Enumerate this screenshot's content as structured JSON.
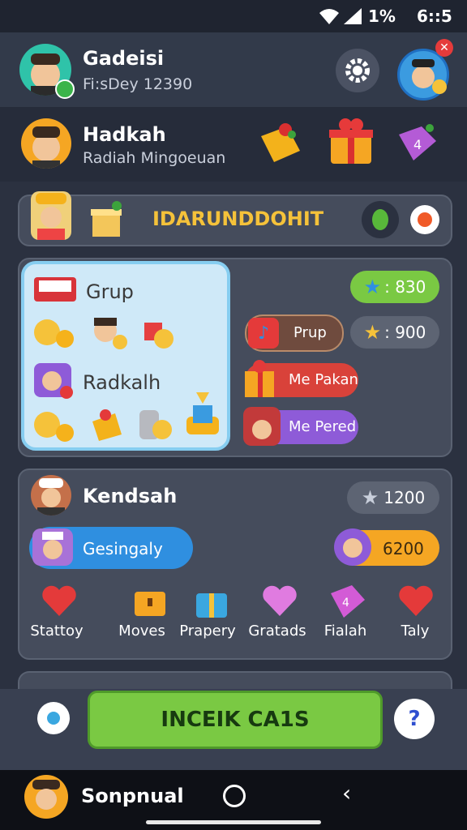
{
  "status_bar": {
    "battery": "1%",
    "time": "6::5"
  },
  "profile": {
    "name": "Gadeisi",
    "subtitle": "Fi:sDey 12390"
  },
  "friend": {
    "name": "Hadkah",
    "subtitle": "Radiah Mingoeuan"
  },
  "banner": {
    "title": "IDARUNDDOHIT"
  },
  "rewards_card": {
    "group_label": "Grup",
    "second_label": "Radkalh"
  },
  "stats": {
    "stars": ": 830",
    "pill_prup": "Prup",
    "stars2": ": 900",
    "me_pakan": "Me Pakan",
    "me_pered": "Me Pered"
  },
  "section2": {
    "name": "Kendsah",
    "score": "1200",
    "tag_label": "Gesingaly",
    "coins": "6200",
    "items": [
      {
        "label": "Stattoy",
        "icon": "heart-icon"
      },
      {
        "label": "Moves",
        "icon": "treasure-box-icon"
      },
      {
        "label": "Prapery",
        "icon": "gift-box-icon"
      },
      {
        "label": "Gratads",
        "icon": "heart-icon"
      },
      {
        "label": "Fialah",
        "icon": "dice-icon"
      },
      {
        "label": "Taly",
        "icon": "heart-icon"
      }
    ]
  },
  "cta": {
    "label": "INCEIK CA1S"
  },
  "nav": {
    "user": "Sonpnual"
  },
  "colors": {
    "green": "#7ac943",
    "orange": "#f5a623",
    "purple": "#8e5bd8",
    "red": "#d9423a",
    "blue": "#2f8fe0"
  }
}
